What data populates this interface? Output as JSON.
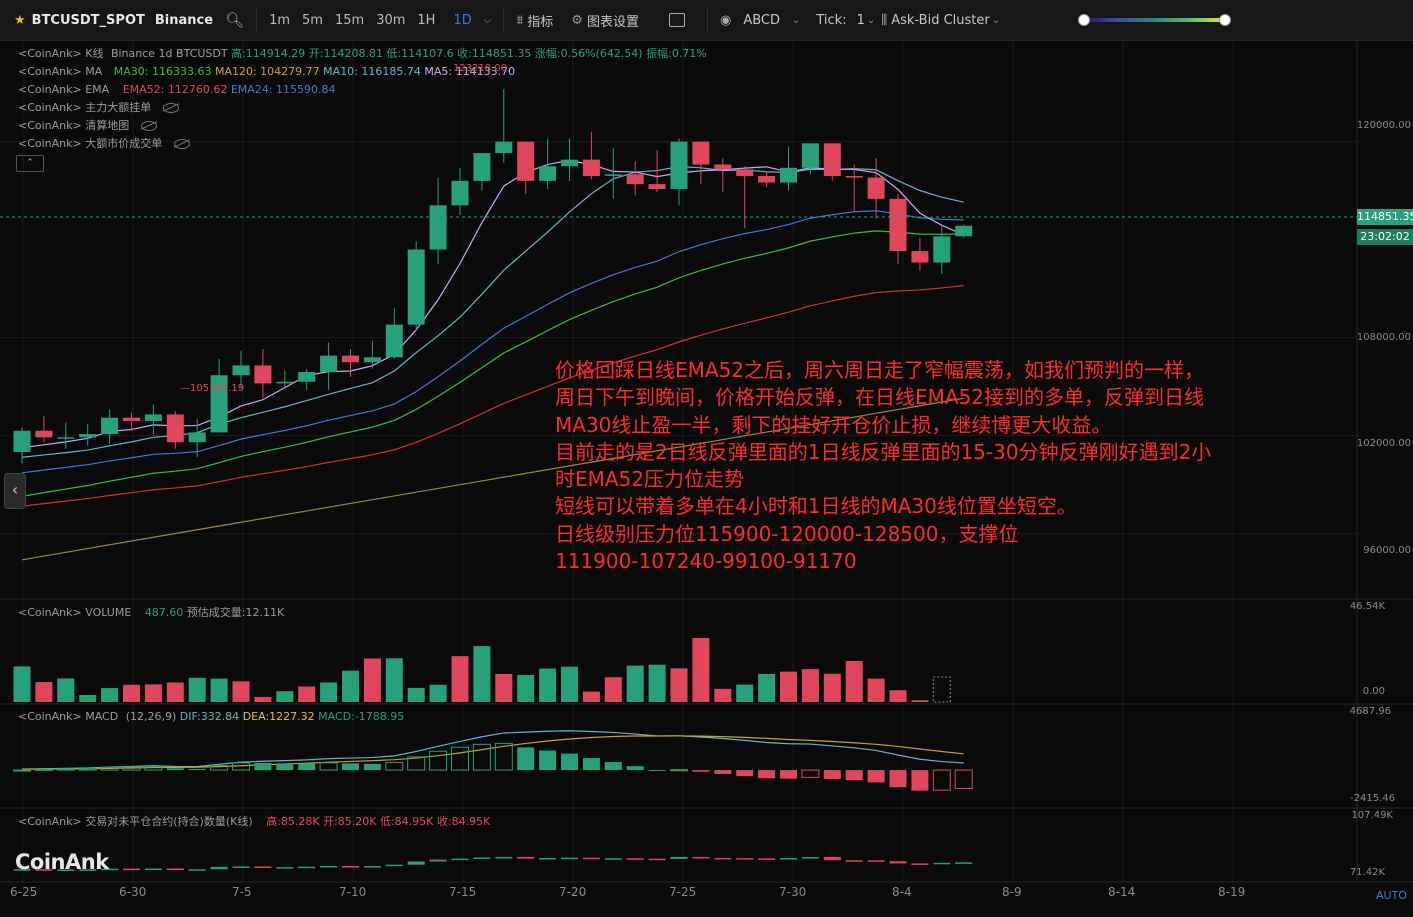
{
  "toolbar": {
    "symbol": "BTCUSDT_SPOT",
    "exchange": "Binance",
    "intervals": [
      "1m",
      "5m",
      "15m",
      "30m",
      "1H",
      "1D"
    ],
    "active_interval": "1D",
    "indicators_label": "指标",
    "settings_label": "图表设置",
    "drawing_tool": "ABCD",
    "tick_label": "Tick:",
    "tick_value": "1",
    "cluster_mode": "Ask-Bid Cluster"
  },
  "legends": {
    "kline": {
      "prefix": "<CoinAnk> K线",
      "source": "Binance 1d BTCUSDT",
      "high": "高:114914.29",
      "open": "开:114208.81",
      "low": "低:114107.6",
      "close": "收:114851.35",
      "change": "涨幅:0.56%(642.54)",
      "amplitude": "振幅:0.71%"
    },
    "ma": {
      "prefix": "<CoinAnk> MA",
      "ma30": "MA30: 116333.63",
      "ma120": "MA120: 104279.77",
      "ma10": "MA10: 116185.74",
      "ma5": "MA5: 114133.70"
    },
    "ema": {
      "prefix": "<CoinAnk> EMA",
      "ema52": "EMA52: 112760.62",
      "ema24": "EMA24: 115590.84"
    },
    "big_orders": "<CoinAnk> 主力大额挂单",
    "heatmap": "<CoinAnk> 清算地图",
    "big_trades": "<CoinAnk> 大额市价成交单",
    "volume": {
      "prefix": "<CoinAnk> VOLUME",
      "value": "487.60",
      "estimate": "预估成交量:12.11K"
    },
    "macd": {
      "prefix": "<CoinAnk> MACD",
      "params": "(12,26,9)",
      "dif": "DIF:332.84",
      "dea": "DEA:1227.32",
      "macd": "MACD:-1788.95"
    },
    "oi": {
      "prefix": "<CoinAnk> 交易对未平仓合约(持合)数量(K线)",
      "high": "高:85.28K",
      "open": "开:85.20K",
      "low": "低:84.95K",
      "close": "收:84.95K"
    }
  },
  "price_tags": {
    "last": "114851.35",
    "countdown": "23:02:02"
  },
  "labels": {
    "low_marker": "105100.19",
    "high_marker": "123218.00"
  },
  "y_axis_main": [
    "120000.00",
    "108000.00",
    "102000.00",
    "96000.00"
  ],
  "y_axis_volume": [
    "46.54K",
    "0.00"
  ],
  "y_axis_macd": [
    "4687.96",
    "-2415.46"
  ],
  "y_axis_oi": [
    "107.49K",
    "71.42K"
  ],
  "x_axis": [
    "6-25",
    "6-30",
    "7-5",
    "7-10",
    "7-15",
    "7-20",
    "7-25",
    "7-30",
    "8-4",
    "8-9",
    "8-14",
    "8-19"
  ],
  "annotation": [
    "价格回踩日线EMA52之后，周六周日走了窄幅震荡，如我们预判的一样，",
    "周日下午到晚间，价格开始反弹，在日线EMA52接到的多单，反弹到日线",
    "MA30线止盈一半，剩下的挂好开仓价止损，继续博更大收益。",
    "目前走的是2日线反弹里面的1日线反弹里面的15-30分钟反弹刚好遇到2小",
    "时EMA52压力位走势",
    "短线可以带着多单在4小时和1日线的MA30线位置坐短空。",
    "日线级别压力位115900-120000-128500，支撑位",
    "111900-107240-99100-91170"
  ],
  "logo": "CoinAnk",
  "auto_label": "AUTO",
  "colors": {
    "up": "#26a17b",
    "down": "#e0475c",
    "ma5": "#c8a8ff",
    "ma10": "#5fb9c9",
    "ma30": "#3f7bd9",
    "ema52": "#d83030",
    "green_line": "#35c23b",
    "long_line": "#9a8a3a",
    "dif": "#5fb9c9",
    "dea": "#c9a227"
  },
  "chart_data": {
    "type": "candlestick",
    "x": [
      "6-22",
      "6-23",
      "6-24",
      "6-25",
      "6-26",
      "6-27",
      "6-28",
      "6-29",
      "6-30",
      "7-1",
      "7-2",
      "7-3",
      "7-4",
      "7-5",
      "7-6",
      "7-7",
      "7-8",
      "7-9",
      "7-10",
      "7-11",
      "7-12",
      "7-13",
      "7-14",
      "7-15",
      "7-16",
      "7-17",
      "7-18",
      "7-19",
      "7-20",
      "7-21",
      "7-22",
      "7-23",
      "7-24",
      "7-25",
      "7-26",
      "7-27",
      "7-28",
      "7-29",
      "7-30",
      "7-31",
      "8-1",
      "8-2",
      "8-3",
      "8-4"
    ],
    "candles": [
      [
        101000,
        102500,
        100300,
        102300
      ],
      [
        102300,
        103200,
        101600,
        101900
      ],
      [
        101900,
        102800,
        101200,
        101900
      ],
      [
        101900,
        102700,
        101400,
        102100
      ],
      [
        102100,
        103600,
        101500,
        103100
      ],
      [
        103100,
        103400,
        102300,
        102900
      ],
      [
        102900,
        103900,
        102100,
        103300
      ],
      [
        103300,
        103500,
        101200,
        101600
      ],
      [
        101600,
        103000,
        100700,
        102200
      ],
      [
        102200,
        106700,
        105100,
        105700
      ],
      [
        105700,
        107200,
        104900,
        106300
      ],
      [
        106300,
        107300,
        104300,
        105200
      ],
      [
        105200,
        106000,
        104900,
        105300
      ],
      [
        105300,
        106100,
        104800,
        105900
      ],
      [
        105900,
        107700,
        104800,
        106900
      ],
      [
        106900,
        107300,
        105600,
        106500
      ],
      [
        106500,
        107800,
        106100,
        106800
      ],
      [
        106800,
        109800,
        106700,
        108800
      ],
      [
        108800,
        113900,
        108400,
        113400
      ],
      [
        113400,
        117800,
        112500,
        116100
      ],
      [
        116100,
        118400,
        115500,
        117600
      ],
      [
        117600,
        119000,
        117000,
        119300
      ],
      [
        119300,
        123218,
        118700,
        120000
      ],
      [
        120000,
        119800,
        116800,
        117600
      ],
      [
        117600,
        120200,
        117100,
        118500
      ],
      [
        118500,
        120200,
        117600,
        118900
      ],
      [
        118900,
        120600,
        117700,
        117900
      ],
      [
        117900,
        119600,
        116500,
        118000
      ],
      [
        118000,
        118800,
        116700,
        117400
      ],
      [
        117400,
        119500,
        116900,
        117100
      ],
      [
        117100,
        120200,
        116100,
        120000
      ],
      [
        120000,
        119600,
        117400,
        118600
      ],
      [
        118600,
        119000,
        116900,
        118300
      ],
      [
        118300,
        118500,
        114700,
        117900
      ],
      [
        117900,
        118200,
        117200,
        117500
      ],
      [
        117500,
        119700,
        117000,
        118400
      ],
      [
        118400,
        119800,
        118000,
        119900
      ],
      [
        119900,
        119300,
        117600,
        117900
      ],
      [
        117900,
        118600,
        115700,
        117800
      ],
      [
        117800,
        119000,
        115300,
        116500
      ],
      [
        116500,
        116800,
        112500,
        113300
      ],
      [
        113300,
        114100,
        112100,
        112600
      ],
      [
        112600,
        114800,
        111900,
        114200
      ],
      [
        114208.81,
        114914.29,
        114107.6,
        114851.35
      ]
    ],
    "volume_up": [
      true,
      false,
      true,
      true,
      true,
      false,
      false,
      false,
      true,
      true,
      false,
      false,
      true,
      false,
      true,
      true,
      false,
      true,
      true,
      true,
      false,
      true,
      false,
      true,
      true,
      true,
      false,
      false,
      true,
      true,
      false,
      false,
      false,
      true,
      true,
      false,
      false,
      false,
      false,
      false,
      false,
      false,
      true,
      true
    ],
    "volume": [
      18.4,
      10.3,
      12.2,
      3.6,
      7.2,
      8.9,
      9.1,
      10.1,
      12.5,
      12.1,
      10.7,
      2.6,
      5.6,
      8.0,
      10.1,
      16.2,
      22.5,
      22.6,
      7.3,
      8.9,
      23.7,
      28.9,
      14.5,
      14.0,
      17.3,
      18.3,
      5.4,
      12.8,
      18.8,
      19.3,
      17.4,
      33.1,
      6.8,
      9.0,
      14.5,
      15.7,
      17.0,
      14.6,
      21.2,
      12.1,
      6.1,
      0.9
    ],
    "ylim": [
      92000,
      125000
    ],
    "volume_ylim": [
      0,
      46.54
    ],
    "macd_ylim": [
      -2415.46,
      4687.96
    ],
    "oi_ylim": [
      71.42,
      107.49
    ]
  }
}
